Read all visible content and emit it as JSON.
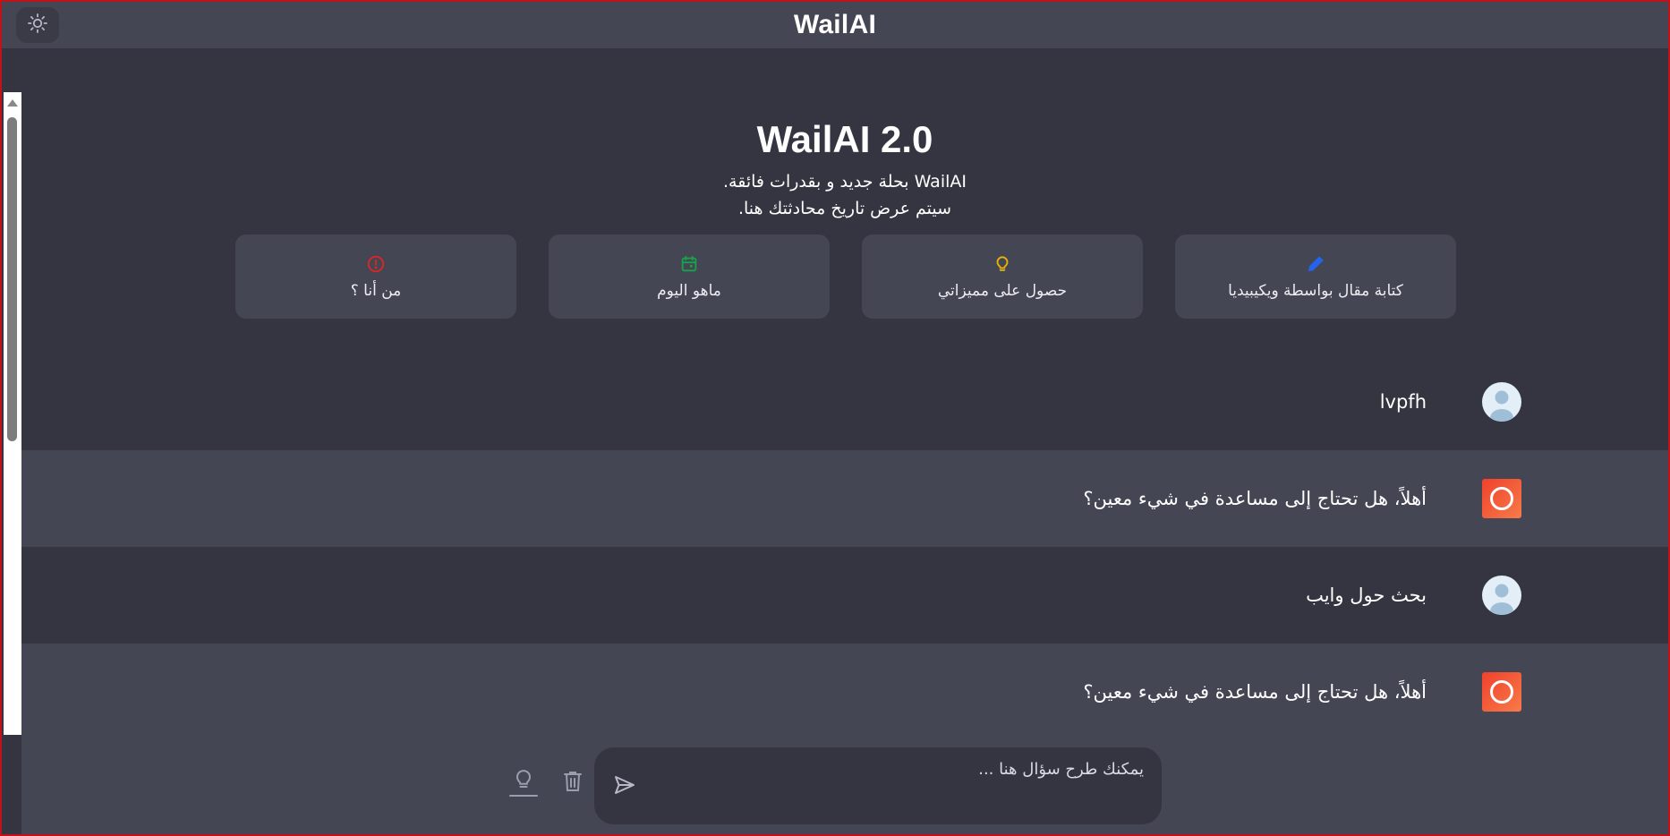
{
  "header": {
    "title": "WailAI",
    "theme_toggle_icon": "sun-icon"
  },
  "hero": {
    "title": "WailAI 2.0",
    "line1": "WailAI بحلة جديد و بقدرات فائقة.",
    "line2": "سيتم عرض تاريخ محادثتك هنا."
  },
  "suggestions": [
    {
      "label": "من أنا ؟",
      "icon": "info-icon",
      "color": "#dc2626"
    },
    {
      "label": "ماهو اليوم",
      "icon": "calendar-icon",
      "color": "#16a34a"
    },
    {
      "label": "حصول على مميزاتي",
      "icon": "lightbulb-icon",
      "color": "#eab308"
    },
    {
      "label": "كتابة مقال بواسطة ويكيبيديا",
      "icon": "pencil-icon",
      "color": "#2563eb"
    }
  ],
  "messages": [
    {
      "role": "user",
      "text": "lvpfh"
    },
    {
      "role": "bot",
      "text": "أهلاً، هل تحتاج إلى مساعدة في شيء معين؟"
    },
    {
      "role": "user",
      "text": "بحث حول وايب"
    },
    {
      "role": "bot",
      "text": "أهلاً، هل تحتاج إلى مساعدة في شيء معين؟"
    }
  ],
  "composer": {
    "placeholder": "يمكنك طرح سؤال هنا ...",
    "value": "",
    "send_icon": "send-icon",
    "delete_icon": "trash-icon",
    "idea_icon": "lightbulb-icon"
  },
  "colors": {
    "background": "#343541",
    "surface": "#444654",
    "bot_avatar": "#f0412c",
    "window_border": "#c0121a"
  }
}
